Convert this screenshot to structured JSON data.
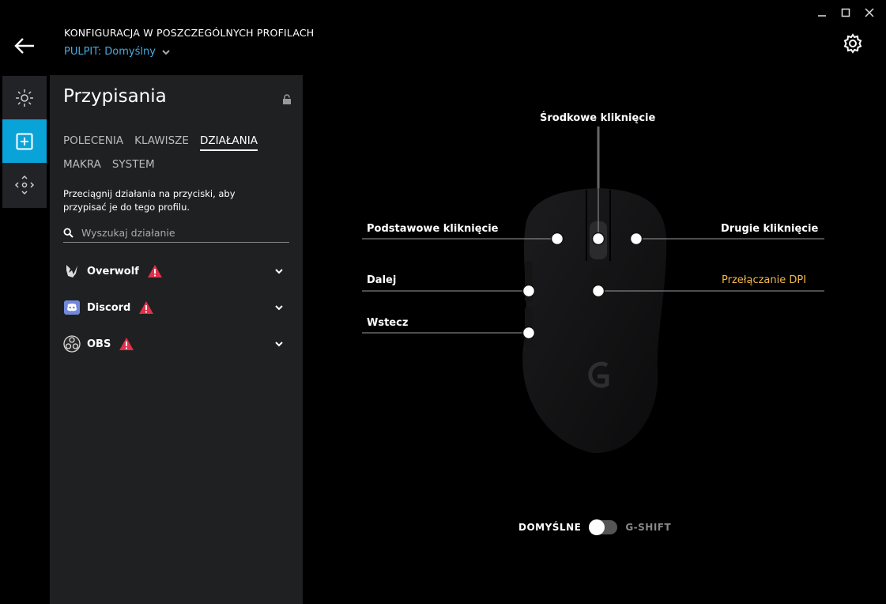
{
  "header": {
    "title": "KONFIGURACJA W POSZCZEGÓLNYCH PROFILACH",
    "profile_label": "PULPIT: Domyślny"
  },
  "panel": {
    "title": "Przypisania",
    "tabs_row1": [
      "POLECENIA",
      "KLAWISZE",
      "DZIAŁANIA"
    ],
    "tabs_row2": [
      "MAKRA",
      "SYSTEM"
    ],
    "selected_tab": "DZIAŁANIA",
    "hint": "Przeciągnij działania na przyciski, aby przypisać je do tego profilu.",
    "search_placeholder": "Wyszukaj działanie",
    "apps": [
      {
        "name": "Overwolf",
        "icon": "overwolf-icon"
      },
      {
        "name": "Discord",
        "icon": "discord-icon"
      },
      {
        "name": "OBS",
        "icon": "obs-icon"
      }
    ]
  },
  "mouse": {
    "middle_click": "Środkowe kliknięcie",
    "primary_click": "Podstawowe kliknięcie",
    "secondary_click": "Drugie kliknięcie",
    "forward": "Dalej",
    "dpi": "Przełączanie DPI",
    "back": "Wstecz"
  },
  "mode": {
    "default_label": "DOMYŚLNE",
    "gshift_label": "G-SHIFT"
  },
  "colors": {
    "accent": "#0aa3d8",
    "link": "#4aa9e0",
    "dpi": "#f2b84b",
    "warning": "#e0304a"
  }
}
